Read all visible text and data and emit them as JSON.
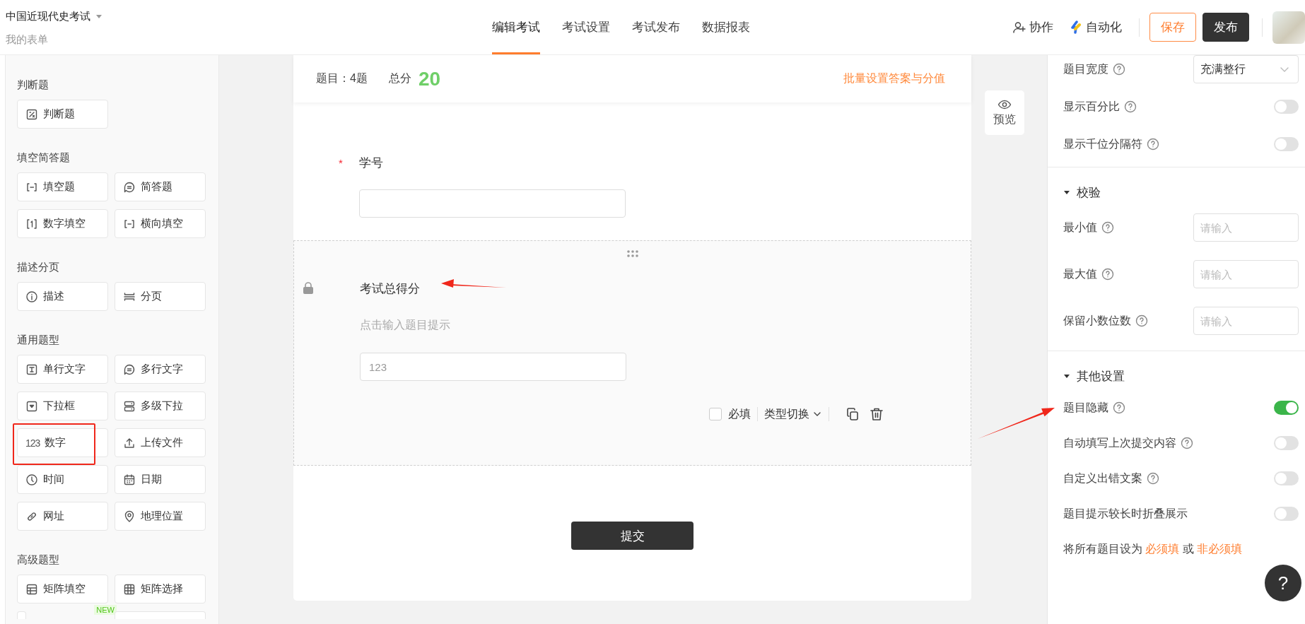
{
  "header": {
    "title": "中国近现代史考试",
    "subtitle": "我的表单",
    "tabs": [
      {
        "label": "编辑考试",
        "selected": true
      },
      {
        "label": "考试设置",
        "selected": false
      },
      {
        "label": "考试发布",
        "selected": false
      },
      {
        "label": "数据报表",
        "selected": false
      }
    ],
    "actions": [
      {
        "kind": "collab",
        "label": "协作"
      },
      {
        "kind": "automation",
        "label": "自动化"
      }
    ],
    "buttons": [
      {
        "kind": "outline",
        "label": "保存"
      },
      {
        "kind": "solid",
        "label": "发布"
      }
    ]
  },
  "palette": {
    "sections": [
      {
        "title": "判断题",
        "items": [
          {
            "kind": "judge",
            "label": "判断题"
          }
        ]
      },
      {
        "title": "填空简答题",
        "items": [
          {
            "kind": "blank",
            "label": "填空题"
          },
          {
            "kind": "essay",
            "label": "简答题"
          },
          {
            "kind": "number-blank",
            "label": "数字填空"
          },
          {
            "kind": "blank",
            "label": "横向填空"
          }
        ]
      },
      {
        "title": "描述分页",
        "items": [
          {
            "kind": "info",
            "label": "描述"
          },
          {
            "kind": "page-break",
            "label": "分页"
          }
        ]
      },
      {
        "title": "通用题型",
        "items": [
          {
            "kind": "single-line",
            "label": "单行文字"
          },
          {
            "kind": "essay",
            "label": "多行文字"
          },
          {
            "kind": "dropdown",
            "label": "下拉框"
          },
          {
            "kind": "cascade",
            "label": "多级下拉"
          },
          {
            "kind": "number",
            "icon_text": "123",
            "label": "数字"
          },
          {
            "kind": "upload",
            "label": "上传文件"
          },
          {
            "kind": "time",
            "label": "时间"
          },
          {
            "kind": "date",
            "label": "日期"
          },
          {
            "kind": "url",
            "label": "网址"
          },
          {
            "kind": "location",
            "label": "地理位置"
          }
        ]
      },
      {
        "title": "高级题型",
        "items": [
          {
            "kind": "matrix-fill",
            "label": "矩阵填空"
          },
          {
            "kind": "matrix-choice",
            "label": "矩阵选择"
          },
          {
            "kind": "more",
            "badge": "NEW"
          },
          {
            "kind": "more"
          }
        ]
      }
    ]
  },
  "canvas": {
    "summary": {
      "count": "题目：4题",
      "score_label": "总分",
      "score": "20",
      "batch_link": "批量设置答案与分值"
    },
    "preview": "预览",
    "required_mark": "*",
    "questions": [
      {
        "title": "学号",
        "required": true,
        "selected": false,
        "locked": false
      },
      {
        "title": "考试总得分",
        "required": false,
        "selected": true,
        "locked": true,
        "hint": "点击输入题目提示",
        "placeholder": "123",
        "required_label": "必填",
        "type_switch": "类型切换"
      }
    ],
    "submit": "提交"
  },
  "settings": {
    "rows": [
      {
        "kind": "select",
        "label": "题目宽度",
        "help": true,
        "value": "充满整行"
      },
      {
        "kind": "toggle",
        "label": "显示百分比",
        "help": true,
        "on": false
      },
      {
        "kind": "toggle",
        "label": "显示千位分隔符",
        "help": true,
        "on": false
      }
    ],
    "sections": [
      {
        "title": "校验",
        "expanded": true,
        "rows": [
          {
            "kind": "input",
            "label": "最小值",
            "help": true,
            "placeholder": "请输入"
          },
          {
            "kind": "input",
            "label": "最大值",
            "help": true,
            "placeholder": "请输入"
          },
          {
            "kind": "input",
            "label": "保留小数位数",
            "help": true,
            "placeholder": "请输入"
          }
        ]
      },
      {
        "title": "其他设置",
        "expanded": true,
        "rows": [
          {
            "kind": "toggle",
            "label": "题目隐藏",
            "help": true,
            "on": true
          },
          {
            "kind": "toggle",
            "label": "自动填写上次提交内容",
            "help": true,
            "on": false
          },
          {
            "kind": "toggle",
            "label": "自定义出错文案",
            "help": true,
            "on": false
          },
          {
            "kind": "toggle",
            "label": "题目提示较长时折叠展示",
            "help": false,
            "on": false
          }
        ]
      }
    ],
    "footer": {
      "text": "将所有题目设为",
      "link_required": "必须填",
      "joiner": "或",
      "link_optional": "非必须填"
    }
  },
  "help_button": "?"
}
